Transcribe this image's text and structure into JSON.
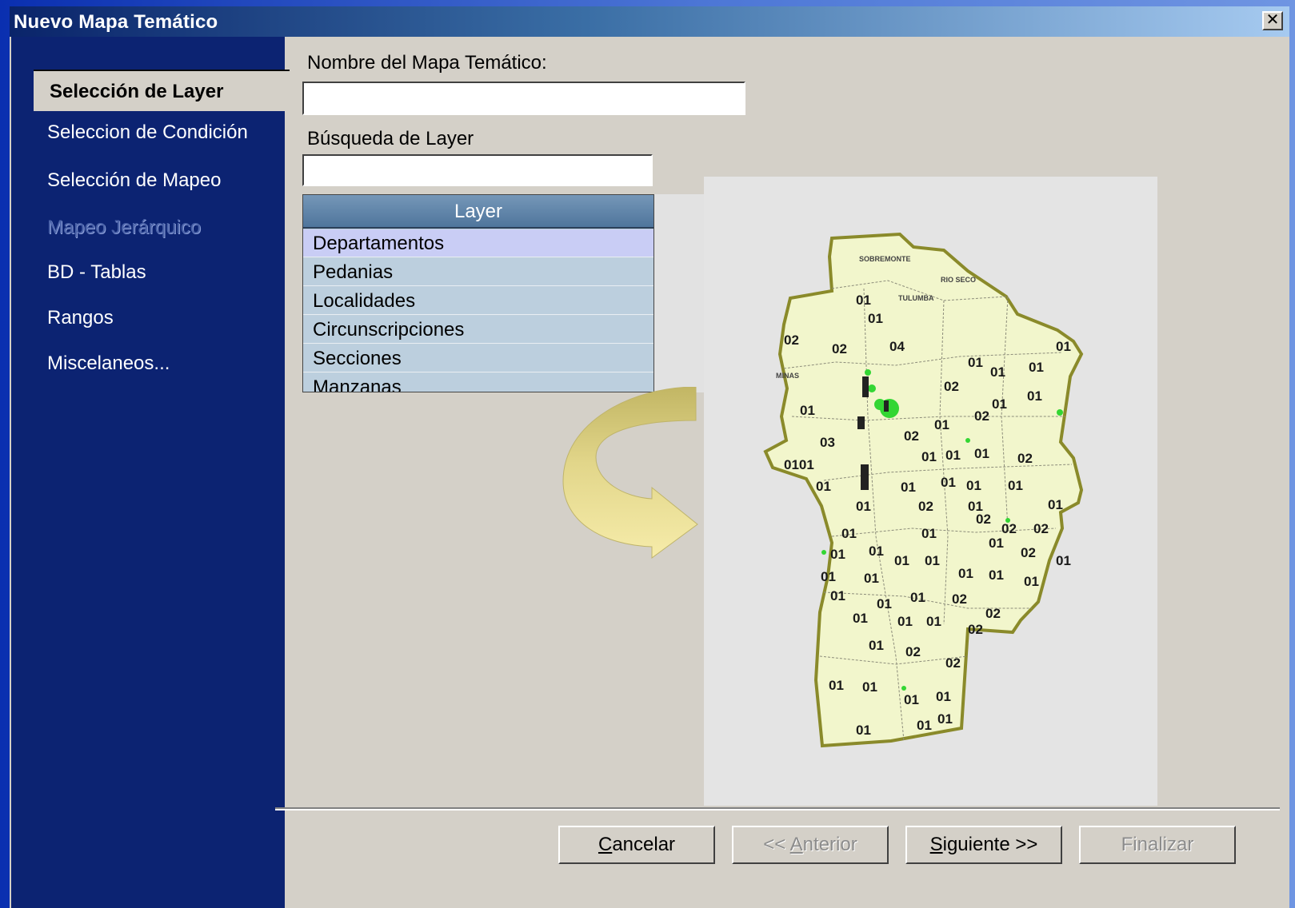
{
  "window": {
    "title": "Nuevo Mapa Temático",
    "close_symbol": "✕"
  },
  "nav": {
    "items": [
      {
        "label": "Selección de Layer",
        "state": "active"
      },
      {
        "label": "Seleccion de Condición",
        "state": "normal"
      },
      {
        "label": "Selección de Mapeo",
        "state": "normal"
      },
      {
        "label": "Mapeo Jerárquico",
        "state": "disabled"
      },
      {
        "label": "BD - Tablas",
        "state": "normal"
      },
      {
        "label": "Rangos",
        "state": "normal"
      },
      {
        "label": "Miscelaneos...",
        "state": "normal"
      }
    ]
  },
  "form": {
    "map_name_label": "Nombre del Mapa Temático:",
    "map_name_value": "",
    "layer_search_label": "Búsqueda de Layer",
    "layer_search_value": ""
  },
  "layer_grid": {
    "header": "Layer",
    "rows": [
      "Departamentos",
      "Pedanias",
      "Localidades",
      "Circunscripciones",
      "Secciones",
      "Manzanas"
    ],
    "selected_index": 0
  },
  "map": {
    "region_names": [
      "SOBREMONTE",
      "RIO SECO",
      "TULUMBA",
      "MINAS"
    ],
    "colors": {
      "fill": "#f2f6cc",
      "border": "#8a8a2a",
      "points": "#33d633",
      "arrow": "#f3e499"
    }
  },
  "buttons": {
    "cancel": {
      "underline": "C",
      "rest": "ancelar"
    },
    "back": {
      "prefix": "<< ",
      "underline": "A",
      "rest": "nterior"
    },
    "next": {
      "underline": "S",
      "rest": "iguiente >>"
    },
    "finish": {
      "label": "Finalizar"
    }
  }
}
